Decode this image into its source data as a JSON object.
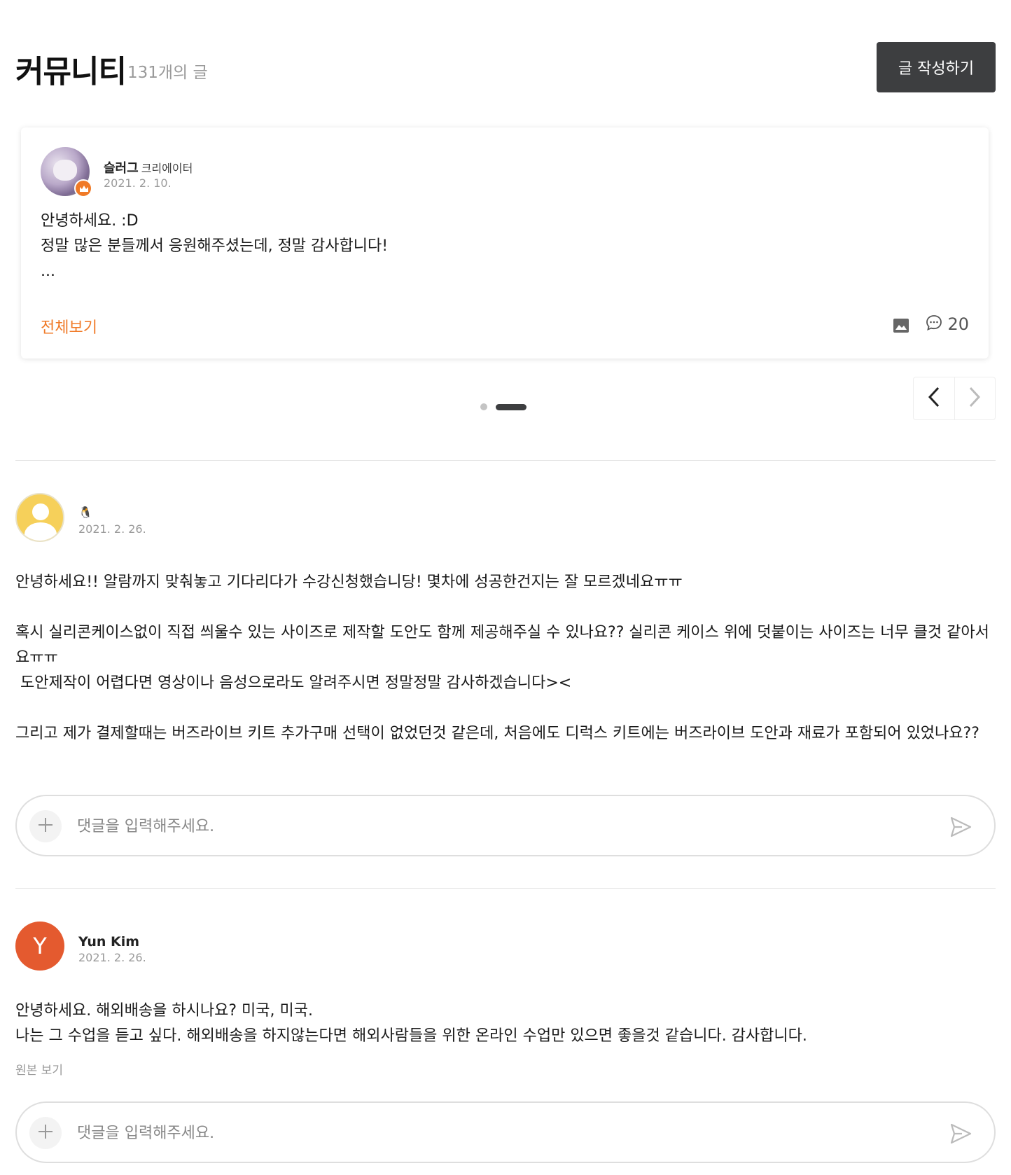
{
  "header": {
    "title": "커뮤니티",
    "post_count": "131개의 글",
    "write_button": "글 작성하기"
  },
  "notice": {
    "author": "슬러그",
    "role": "크리에이터",
    "date": "2021. 2. 10.",
    "body_lines": [
      "안녕하세요. :D",
      "정말 많은 분들께서 응원해주셨는데, 정말 감사합니다!",
      "..."
    ],
    "see_all": "전체보기",
    "comment_count": "20"
  },
  "carousel": {
    "pages": 2,
    "active_index": 1
  },
  "posts": [
    {
      "author": "🐧",
      "date": "2021. 2. 26.",
      "paragraphs": [
        "안녕하세요!! 알람까지 맞춰놓고 기다리다가 수강신청했습니당! 몇차에 성공한건지는 잘 모르겠네요ㅠㅠ",
        "혹시 실리콘케이스없이 직접 씌울수 있는 사이즈로 제작할 도안도 함께 제공해주실 수 있나요?? 실리콘 케이스 위에 덧붙이는 사이즈는 너무 클것 같아서요ㅠㅠ\n 도안제작이 어렵다면 영상이나 음성으로라도 알려주시면 정말정말 감사하겠습니다><",
        "그리고 제가 결제할때는 버즈라이브 키트 추가구매 선택이 없었던것 같은데, 처음에도 디럭스 키트에는 버즈라이브 도안과 재료가 포함되어 있었나요??"
      ],
      "comment_placeholder": "댓글을 입력해주세요."
    },
    {
      "author": "Yun Kim",
      "avatar_letter": "Y",
      "date": "2021. 2. 26.",
      "paragraphs": [
        "안녕하세요. 해외배송을 하시나요? 미국, 미국.\n나는 그 수업을 듣고 싶다. 해외배송을 하지않는다면 해외사람들을 위한 온라인 수업만 있으면 좋을것 같습니다. 감사합니다."
      ],
      "original_link": "원본 보기",
      "comment_placeholder": "댓글을 입력해주세요."
    }
  ],
  "colors": {
    "accent": "#f07a27",
    "button_dark": "#3d3e40",
    "avatar_yellow": "#f6d05a",
    "avatar_orange": "#e45a2f"
  },
  "icons": [
    "crown-icon",
    "image-icon",
    "comment-icon",
    "chevron-left-icon",
    "chevron-right-icon",
    "user-icon",
    "plus-icon",
    "send-icon"
  ]
}
